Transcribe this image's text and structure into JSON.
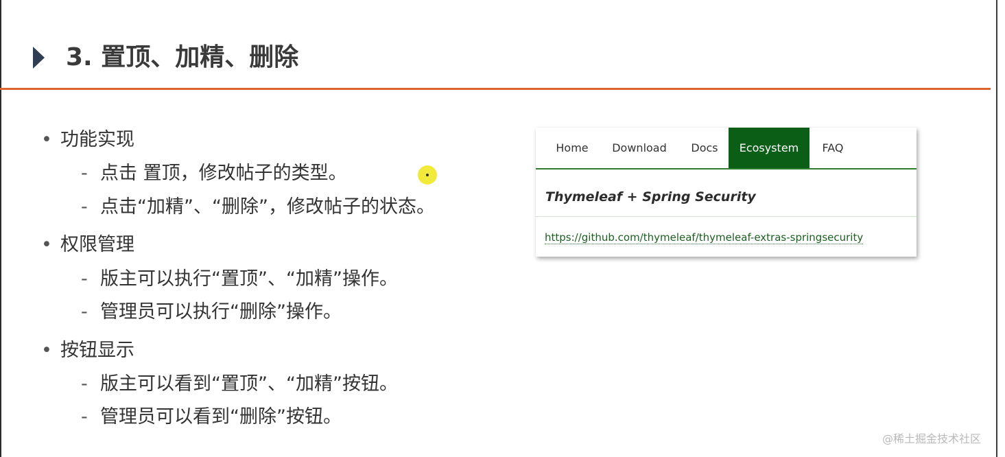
{
  "slide": {
    "title": "3. 置顶、加精、删除",
    "bullets": [
      {
        "text": "功能实现",
        "items": [
          "点击 置顶，修改帖子的类型。",
          "点击“加精”、“删除”，修改帖子的状态。"
        ]
      },
      {
        "text": "权限管理",
        "items": [
          "版主可以执行“置顶”、“加精”操作。",
          "管理员可以执行“删除”操作。"
        ]
      },
      {
        "text": "按钮显示",
        "items": [
          "版主可以看到“置顶”、“加精”按钮。",
          "管理员可以看到“删除”按钮。"
        ]
      }
    ],
    "bullet_mark": "•",
    "dash_mark": "-"
  },
  "screenshot": {
    "nav": [
      "Home",
      "Download",
      "Docs",
      "Ecosystem",
      "FAQ"
    ],
    "active_nav": "Ecosystem",
    "heading": "Thymeleaf + Spring Security",
    "link": "https://github.com/thymeleaf/thymeleaf-extras-springsecurity"
  },
  "watermark": "@稀土掘金技术社区",
  "colors": {
    "title_rule": "#d9672d",
    "active_tab": "#0b5e16",
    "link": "#1b5e20",
    "cursor_highlight": "#f2ea3a"
  },
  "icons": {
    "title_marker": "caret-right-icon"
  }
}
